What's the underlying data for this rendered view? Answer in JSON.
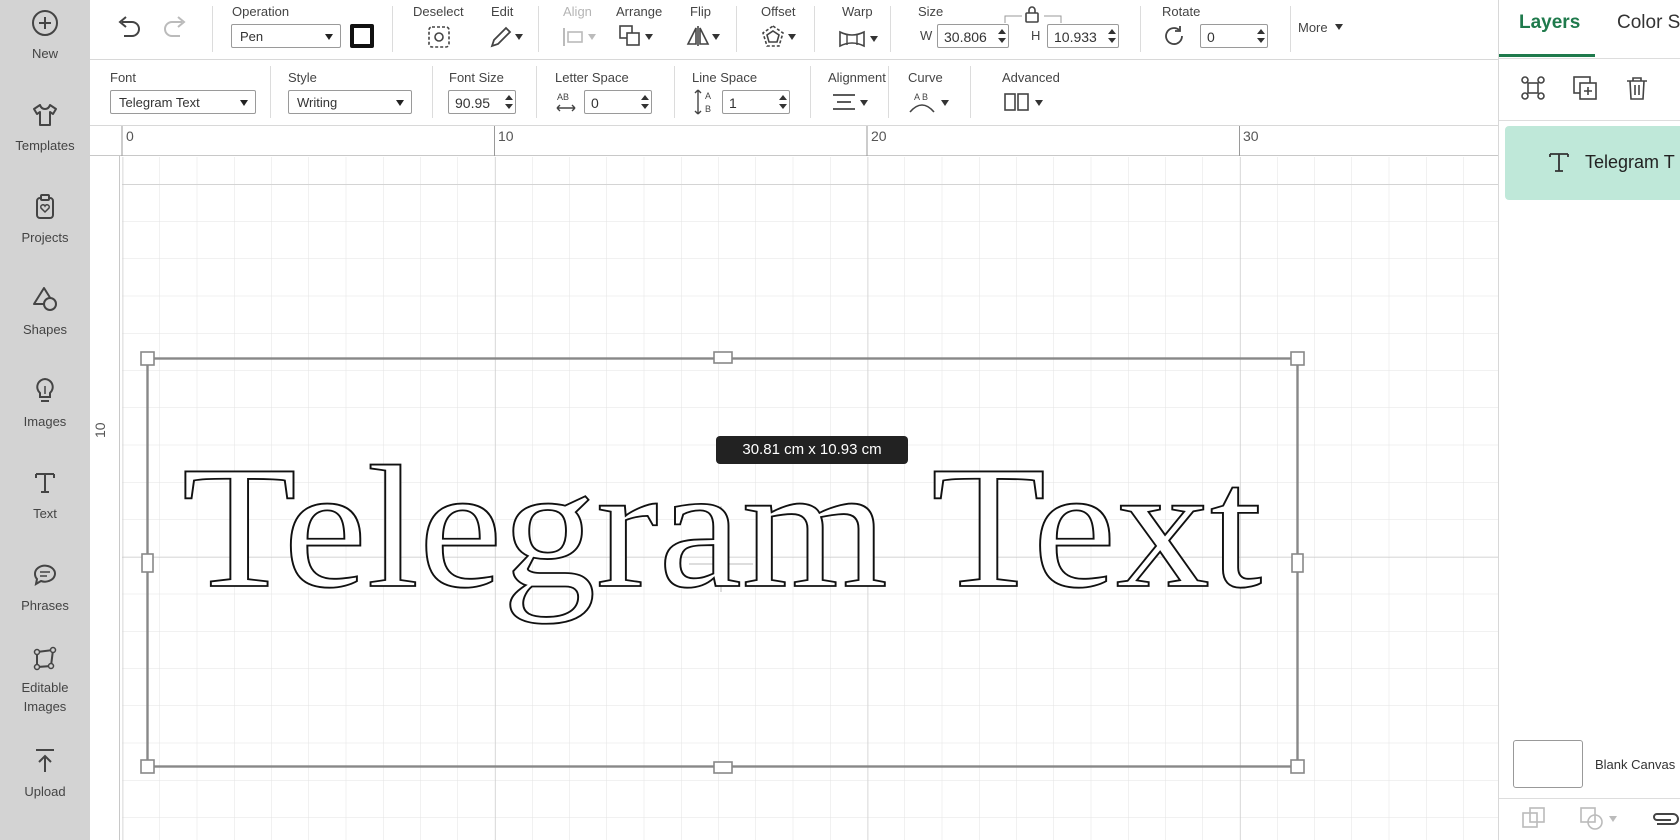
{
  "sidebar": {
    "items": [
      {
        "label": "New",
        "icon": "plus-circle-icon"
      },
      {
        "label": "Templates",
        "icon": "tshirt-icon"
      },
      {
        "label": "Projects",
        "icon": "clipboard-heart-icon"
      },
      {
        "label": "Shapes",
        "icon": "shapes-icon"
      },
      {
        "label": "Images",
        "icon": "lightbulb-icon"
      },
      {
        "label": "Text",
        "icon": "text-t-icon"
      },
      {
        "label": "Phrases",
        "icon": "speech-bubble-icon"
      },
      {
        "label": "Editable Images",
        "icon": "editable-image-icon"
      },
      {
        "label": "Upload",
        "icon": "upload-icon"
      }
    ]
  },
  "toolbar": {
    "operation_label": "Operation",
    "operation_value": "Pen",
    "deselect_label": "Deselect",
    "edit_label": "Edit",
    "align_label": "Align",
    "arrange_label": "Arrange",
    "flip_label": "Flip",
    "offset_label": "Offset",
    "warp_label": "Warp",
    "size_label": "Size",
    "width_letter": "W",
    "width_value": "30.806",
    "height_letter": "H",
    "height_value": "10.933",
    "rotate_label": "Rotate",
    "rotate_value": "0",
    "more_label": "More"
  },
  "textbar": {
    "font_label": "Font",
    "font_value": "Telegram Text",
    "style_label": "Style",
    "style_value": "Writing",
    "fontsize_label": "Font Size",
    "fontsize_value": "90.95",
    "letterspace_label": "Letter Space",
    "letterspace_value": "0",
    "linespace_label": "Line Space",
    "linespace_value": "1",
    "alignment_label": "Alignment",
    "curve_label": "Curve",
    "advanced_label": "Advanced"
  },
  "canvas": {
    "ruler_top": [
      "0",
      "10",
      "20",
      "30"
    ],
    "ruler_left": [
      "10"
    ],
    "dimension_tooltip": "30.81  cm x 10.93  cm",
    "text_content": "Telegram Text"
  },
  "right_panel": {
    "tabs": [
      "Layers",
      "Color S"
    ],
    "layer_name": "Telegram T",
    "blank_canvas_label": "Blank Canvas"
  },
  "colors": {
    "accent": "#1f7a4c",
    "layer_selected": "#bfe8d9",
    "sidebar_bg": "#d3d3d3"
  }
}
